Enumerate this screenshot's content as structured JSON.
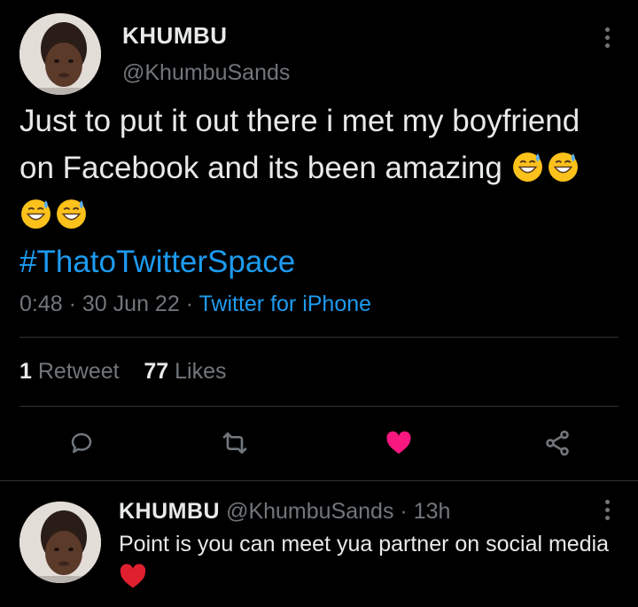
{
  "tweet": {
    "display_name": "KHUMBU",
    "handle": "@KhumbuSands",
    "text": "Just to put it out there i met my boyfriend on Facebook and its been amazing",
    "emojis": [
      "grinning-sweat-emoji",
      "grinning-sweat-emoji",
      "grinning-sweat-emoji",
      "grinning-sweat-emoji"
    ],
    "hashtag": "#ThatoTwitterSpace",
    "time": "0:48",
    "date": "30 Jun 22",
    "source": "Twitter for iPhone",
    "separator": "·",
    "retweet_count": "1",
    "retweet_label": "Retweet",
    "like_count": "77",
    "like_label": "Likes"
  },
  "reply": {
    "display_name": "KHUMBU",
    "handle": "@KhumbuSands",
    "age": "13h",
    "separator": "·",
    "text": "Point is you can meet yua partner on social media",
    "emoji": "red-heart-emoji"
  },
  "colors": {
    "background": "#000000",
    "text": "#e7e9ea",
    "secondary": "#71767b",
    "link": "#1d9bf0",
    "like": "#f91880",
    "divider": "#2f3336"
  },
  "icons": [
    "reply-icon",
    "retweet-icon",
    "like-icon-filled",
    "share-icon",
    "more-icon"
  ]
}
